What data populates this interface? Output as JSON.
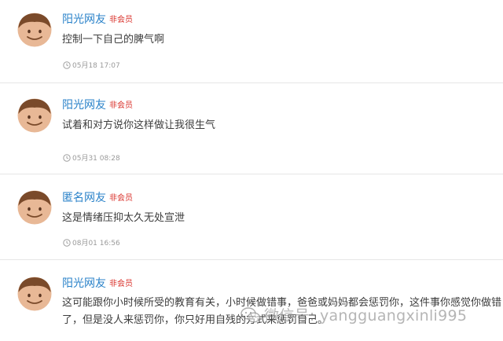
{
  "comments": [
    {
      "username": "阳光网友",
      "badge": "非会员",
      "text": "控制一下自己的脾气啊",
      "time": "05月18 17:07"
    },
    {
      "username": "阳光网友",
      "badge": "非会员",
      "text": "试着和对方说你这样做让我很生气",
      "time": "05月31 08:28"
    },
    {
      "username": "匿名网友",
      "badge": "非会员",
      "text": "这是情绪压抑太久无处宣泄",
      "time": "08月01 16:56"
    },
    {
      "username": "阳光网友",
      "badge": "非会员",
      "text": "这可能跟你小时候所受的教育有关，小时候做错事，爸爸或妈妈都会惩罚你，这件事你感觉你做错了，但是没人来惩罚你，你只好用自残的方式来惩罚自己。"
    }
  ],
  "watermark": {
    "text": "微信号: yangguangxinli995"
  },
  "icons": {
    "avatar": "smiley-face-avatar",
    "time": "clock-icon",
    "watermark": "wechat-icon"
  }
}
